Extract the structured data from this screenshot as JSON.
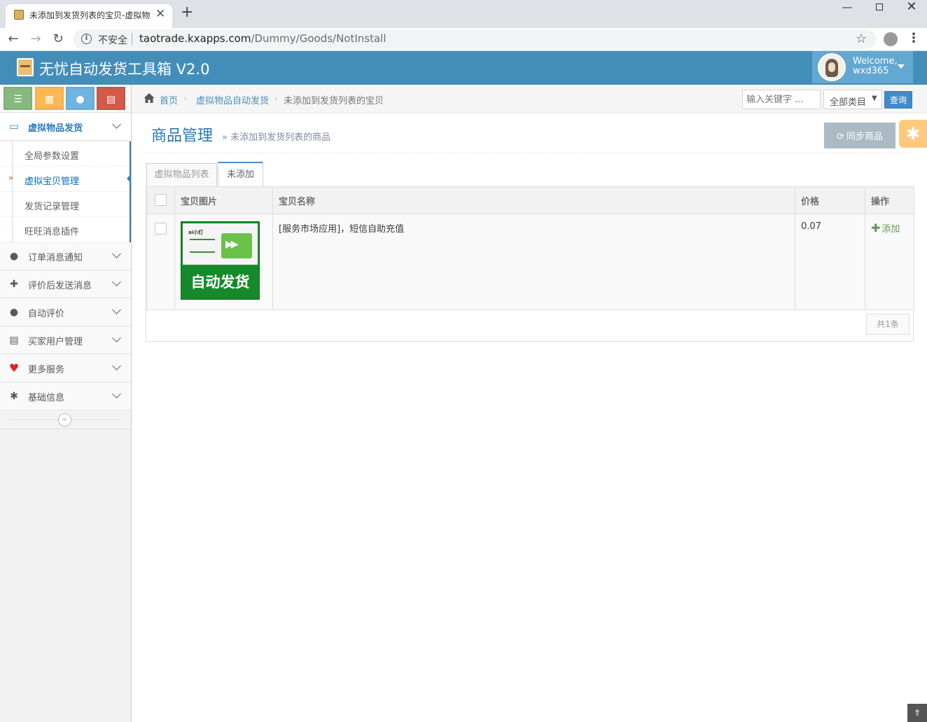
{
  "browser": {
    "tab_title": "未添加到发货列表的宝贝-虚拟物",
    "tab_close": "✕",
    "new_tab": "+",
    "insecure_label": "不安全",
    "url_host": "taotrade.kxapps.com",
    "url_path": "/Dummy/Goods/NotInstall"
  },
  "header": {
    "app_title": "无忧自动发货工具箱 V2.0",
    "welcome": "Welcome,",
    "username": "wxd365"
  },
  "sidebar": {
    "shortcuts": [
      {
        "icon": "list-icon",
        "color": "#87b87f"
      },
      {
        "icon": "calendar-icon",
        "color": "#ffb752"
      },
      {
        "icon": "chat-icon",
        "color": "#6fb3e0"
      },
      {
        "icon": "book-icon",
        "color": "#d15b47"
      }
    ],
    "menu": [
      {
        "label": "虚拟物品发货",
        "icon": "card-icon",
        "active": true
      },
      {
        "label": "订单消息通知",
        "icon": "comment-icon"
      },
      {
        "label": "评价后发送消息",
        "icon": "gift-icon"
      },
      {
        "label": "自动评价",
        "icon": "comment-icon"
      },
      {
        "label": "买家用户管理",
        "icon": "book-icon"
      },
      {
        "label": "更多服务",
        "icon": "heart-icon"
      },
      {
        "label": "基础信息",
        "icon": "gear-icon"
      }
    ],
    "submenu": [
      {
        "label": "全局参数设置"
      },
      {
        "label": "虚拟宝贝管理",
        "active": true
      },
      {
        "label": "发货记录管理"
      },
      {
        "label": "旺旺消息插件"
      }
    ],
    "active_marker": "»",
    "collapse_glyph": "«"
  },
  "breadcrumbs": {
    "home": "首页",
    "level2": "虚拟物品自动发货",
    "level3": "未添加到发货列表的宝贝",
    "separator": "›",
    "search_placeholder": "输入关键字 ...",
    "category_value": "全部类目",
    "query_button": "查询"
  },
  "page": {
    "title": "商品管理",
    "subtitle": "» 未添加到发货列表的商品",
    "sync_button": "同步商品",
    "tabs": [
      "虚拟物品列表",
      "未添加"
    ],
    "active_tab": 1
  },
  "table": {
    "headers": [
      "宝贝图片",
      "宝贝名称",
      "价格",
      "操作"
    ],
    "rows": [
      {
        "image_caption": "自动发货",
        "image_tag": "ai小灯",
        "name": "[服务市场应用]，短信自助充值",
        "price": "0.07",
        "action": "添加"
      }
    ],
    "total": "共1条"
  },
  "colors": {
    "header_bg": "#438eb9",
    "user_box": "#62a8d1",
    "link_blue": "#4c8fbd",
    "title_blue": "#2679b5",
    "add_green": "#629b58"
  }
}
